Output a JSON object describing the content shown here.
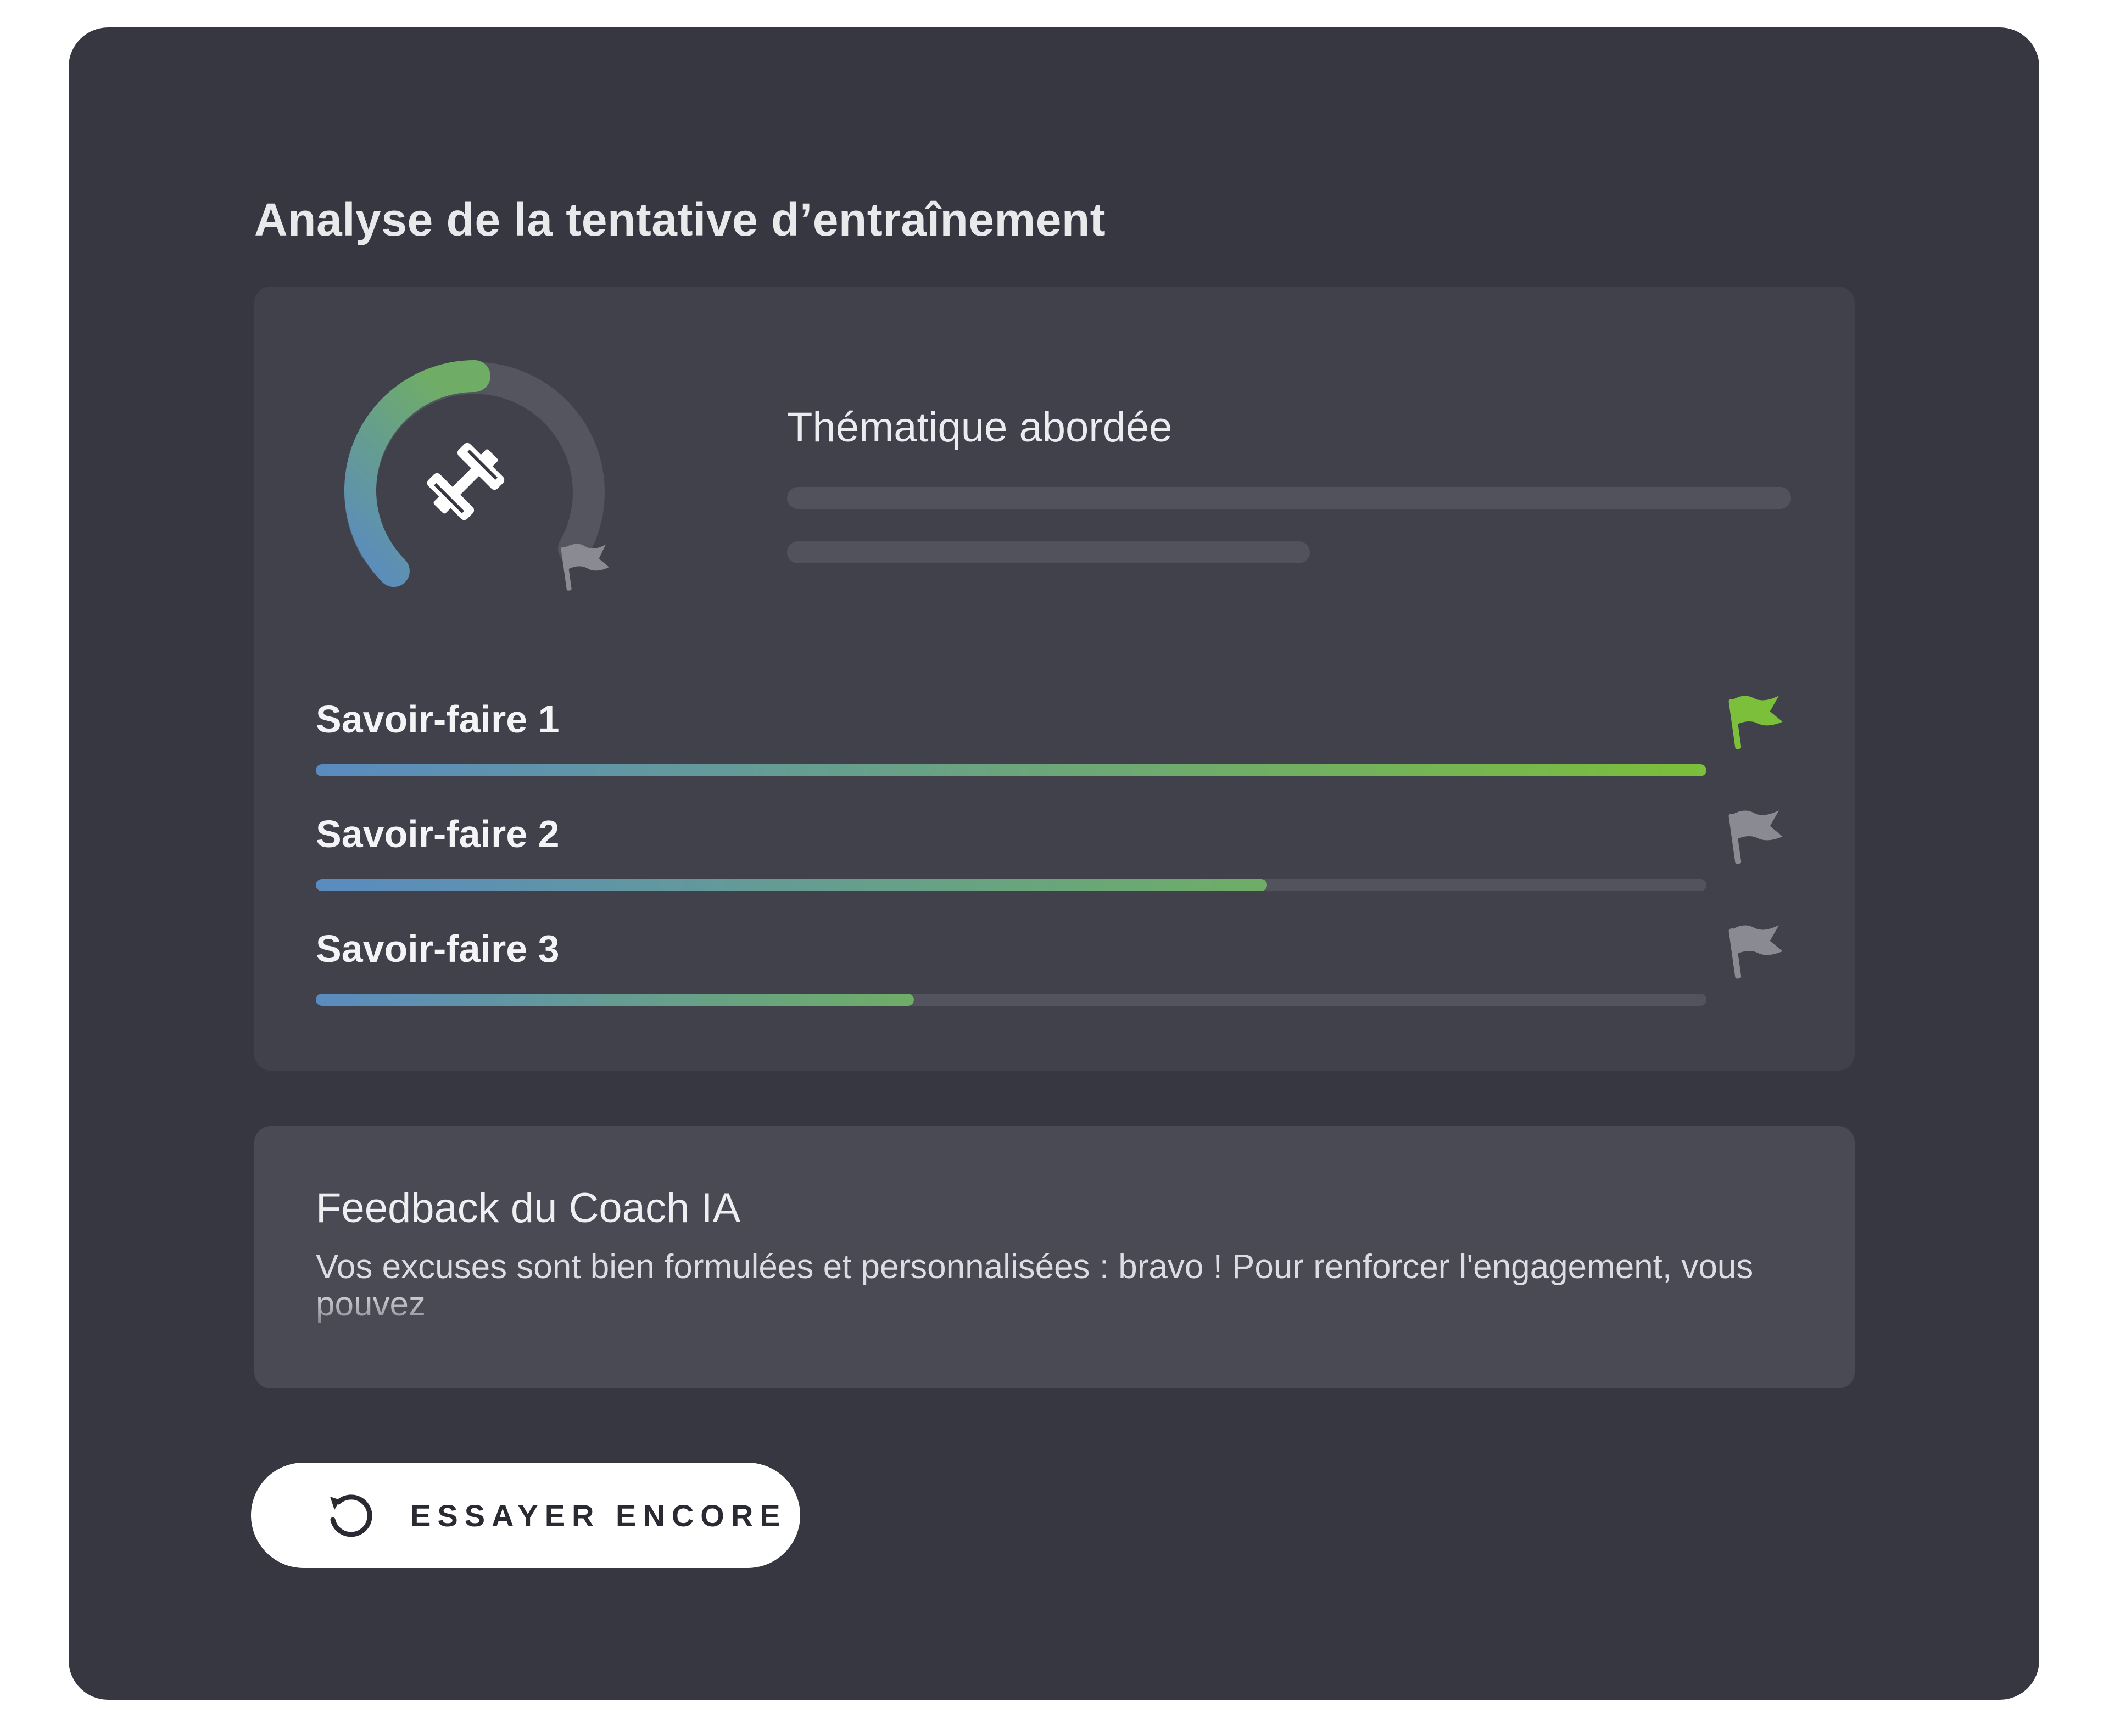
{
  "header": {
    "title": "Analyse de la tentative d’entraînement"
  },
  "analysis": {
    "gauge": {
      "progress": 0.5,
      "icon": "dumbbell-icon",
      "marker_icon": "flag-icon",
      "gradient_colors": [
        "#5a8bc0",
        "#6fad66"
      ],
      "track_color": "#55555f"
    },
    "theme": {
      "title": "Thématique abordée"
    },
    "skills": [
      {
        "label": "Savoir-faire 1",
        "progress": 1.0,
        "flag_color": "#7bbf3a",
        "achieved": true
      },
      {
        "label": "Savoir-faire 2",
        "progress": 0.684,
        "flag_color": "#8a8a93",
        "achieved": false
      },
      {
        "label": "Savoir-faire 3",
        "progress": 0.43,
        "flag_color": "#8a8a93",
        "achieved": false
      }
    ]
  },
  "feedback": {
    "title": "Feedback du Coach IA",
    "text": "Vos excuses sont bien formulées et personnalisées : bravo ! Pour renforcer l'engagement, vous pouvez"
  },
  "actions": {
    "retry_label": "ESSAYER ENCORE",
    "retry_icon": "refresh-icon"
  },
  "colors": {
    "card_background": "#373741",
    "panel_background": "#41414b",
    "feedback_background": "#4a4a54",
    "progress_start": "#5a8bc0",
    "progress_mid": "#6fad66",
    "progress_end": "#7bbf3a",
    "track": "#53535d"
  }
}
